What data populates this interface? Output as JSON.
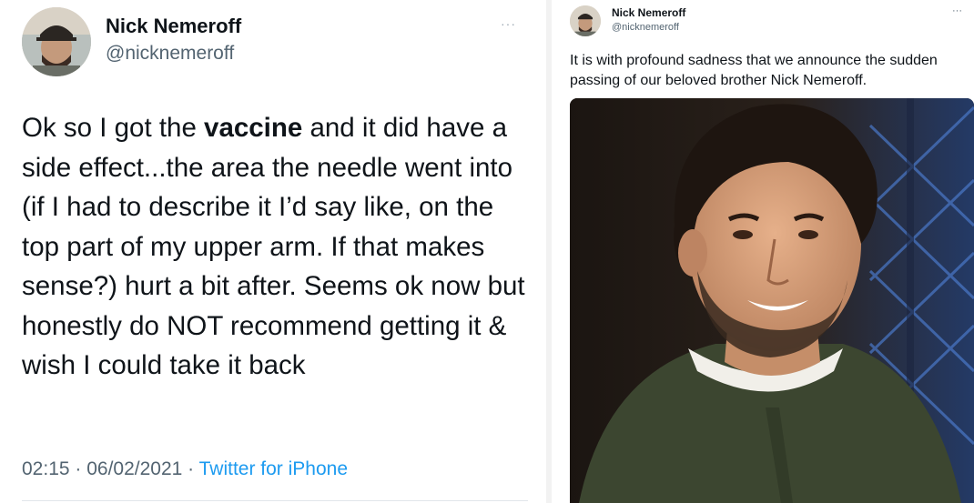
{
  "left_tweet": {
    "name": "Nick Nemeroff",
    "handle": "@nicknemeroff",
    "more": "···",
    "text_before": "Ok so I got the ",
    "text_bold": "vaccine",
    "text_after": " and it did have a side effect...the area the needle went into (if I had to describe it I’d say like, on the top part of my upper arm. If that makes sense?) hurt a bit after. Seems ok now but honestly do NOT recommend getting it & wish I could take it back",
    "time": "02:15 · 06/02/2021 · ",
    "source": "Twitter for iPhone"
  },
  "right_tweet": {
    "name": "Nick Nemeroff",
    "handle": "@nicknemeroff",
    "more": "···",
    "text": "It is with profound sadness that we announce the sudden passing of our beloved brother Nick Nemeroff."
  },
  "colors": {
    "text": "#0f1419",
    "secondary": "#536471",
    "link": "#1d9bf0"
  },
  "icons": {
    "more": "more-options-icon"
  }
}
